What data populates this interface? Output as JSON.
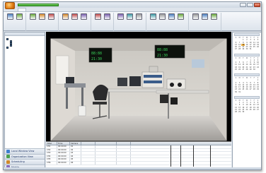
{
  "window": {
    "title": ""
  },
  "tabs": [
    "",
    "",
    "",
    ""
  ],
  "ribbon": {
    "groups": [
      {
        "buttons": [
          "",
          ""
        ],
        "label": ""
      },
      {
        "buttons": [
          "",
          "",
          ""
        ],
        "label": ""
      },
      {
        "buttons": [
          "",
          "",
          ""
        ],
        "label": ""
      },
      {
        "buttons": [
          "",
          ""
        ],
        "label": ""
      },
      {
        "buttons": [
          "",
          "",
          ""
        ],
        "label": ""
      },
      {
        "buttons": [
          "",
          "",
          "",
          ""
        ],
        "label": ""
      },
      {
        "buttons": [
          "",
          "",
          ""
        ],
        "label": ""
      }
    ]
  },
  "colors": {
    "accent": "#e07b12",
    "progress": "#2f9b22",
    "selected_day": "#f3b64a",
    "nav_text": "#1e3566"
  },
  "left_pane": {
    "header": "",
    "tree": [
      {
        "label": "",
        "level": 0
      },
      {
        "label": "",
        "level": 1
      },
      {
        "label": "",
        "level": 1
      },
      {
        "label": "",
        "level": 1
      },
      {
        "label": "",
        "level": 0
      }
    ],
    "nav": [
      "Local Window View",
      "Organization View",
      "Scheduling",
      "Mobile"
    ]
  },
  "grid": {
    "columns": [
      "Video",
      "Time",
      "Camera",
      "",
      "",
      ""
    ],
    "rows": [
      [
        "CH1",
        "00:00:00",
        "01",
        "",
        "",
        ""
      ],
      [
        "CH2",
        "00:00:00",
        "02",
        "",
        "",
        ""
      ],
      [
        "CH3",
        "00:00:00",
        "03",
        "",
        "",
        ""
      ],
      [
        "CH4",
        "00:00:00",
        "04",
        "",
        "",
        ""
      ],
      [
        "CH5",
        "00:00:00",
        "05",
        "",
        "",
        ""
      ],
      [
        "CH6",
        "00:00:00",
        "06",
        "",
        "",
        ""
      ]
    ]
  },
  "calendars": [
    {
      "month": "",
      "days": [
        "S",
        "M",
        "T",
        "W",
        "T",
        "F",
        "S"
      ],
      "dates": [
        "",
        "",
        "1",
        "2",
        "3",
        "4",
        "5",
        "6",
        "7",
        "8",
        "9",
        "10",
        "11",
        "12",
        "13",
        "14",
        "15",
        "16",
        "17",
        "18",
        "19",
        "20",
        "21",
        "22",
        "23",
        "24",
        "25",
        "26",
        "27",
        "28",
        "29",
        "30",
        "31"
      ],
      "selected": "15"
    },
    {
      "month": "",
      "days": [
        "S",
        "M",
        "T",
        "W",
        "T",
        "F",
        "S"
      ],
      "dates": [
        "",
        "",
        "",
        "",
        "1",
        "2",
        "3",
        "4",
        "5",
        "6",
        "7",
        "8",
        "9",
        "10",
        "11",
        "12",
        "13",
        "14",
        "15",
        "16",
        "17",
        "18",
        "19",
        "20",
        "21",
        "22",
        "23",
        "24",
        "25",
        "26",
        "27",
        "28",
        "29",
        "30"
      ],
      "selected": ""
    },
    {
      "month": "",
      "days": [
        "S",
        "M",
        "T",
        "W",
        "T",
        "F",
        "S"
      ],
      "dates": [
        "",
        "",
        "",
        "",
        "",
        "",
        "1",
        "2",
        "3",
        "4",
        "5",
        "6",
        "7",
        "8",
        "9",
        "10",
        "11",
        "12",
        "13",
        "14",
        "15",
        "16",
        "17",
        "18",
        "19",
        "20",
        "21",
        "22",
        "23",
        "24",
        "25",
        "26",
        "27",
        "28",
        "29",
        "30",
        "31"
      ],
      "selected": ""
    },
    {
      "month": "",
      "days": [
        "S",
        "M",
        "T",
        "W",
        "T",
        "F",
        "S"
      ],
      "dates": [
        "",
        "1",
        "2",
        "3",
        "4",
        "5",
        "6",
        "7",
        "8",
        "9",
        "10",
        "11",
        "12",
        "13",
        "14",
        "15",
        "16",
        "17",
        "18",
        "19",
        "20",
        "21",
        "22",
        "23",
        "24",
        "25",
        "26",
        "27",
        "28",
        "29",
        "30"
      ],
      "selected": ""
    }
  ],
  "footer": {
    "text": "",
    "tail": "—— ——"
  }
}
